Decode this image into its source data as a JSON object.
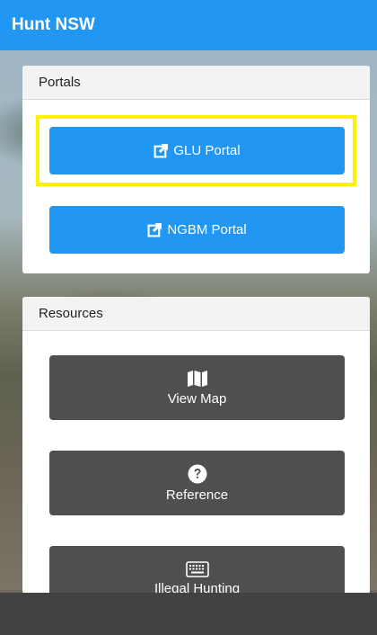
{
  "app": {
    "title": "Hunt NSW"
  },
  "portals": {
    "heading": "Portals",
    "buttons": [
      {
        "label": "GLU Portal",
        "icon": "external-link-icon"
      },
      {
        "label": "NGBM Portal",
        "icon": "external-link-icon"
      }
    ]
  },
  "resources": {
    "heading": "Resources",
    "buttons": [
      {
        "label": "View Map",
        "icon": "map-icon"
      },
      {
        "label": "Reference",
        "icon": "question-circle-icon"
      },
      {
        "label": "Illegal Hunting",
        "icon": "keyboard-icon"
      }
    ]
  },
  "colors": {
    "primary": "#2196f3",
    "dark_button": "#4f4f4f",
    "highlight": "#fff200",
    "bottom_bar": "#424242"
  }
}
